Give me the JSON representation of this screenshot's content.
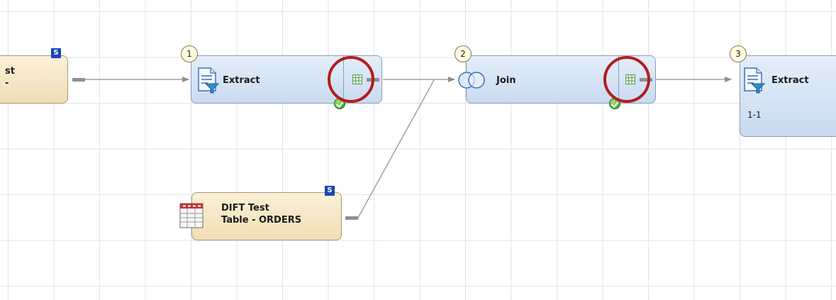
{
  "canvas": {
    "nodes": {
      "source_table": {
        "label": "st\n-",
        "badge": "S"
      },
      "extract_1": {
        "step": "1",
        "label": "Extract"
      },
      "join_2": {
        "step": "2",
        "label": "Join"
      },
      "extract_3": {
        "step": "3",
        "label": "Extract",
        "sublabel": "1-1"
      },
      "orders_table": {
        "label": "DIFT Test\nTable - ORDERS",
        "badge": "S"
      }
    }
  },
  "colors": {
    "transform_node": "#c9dbf0",
    "table_node": "#f0dfb5",
    "highlight": "#b21d1d",
    "status_ok": "#2f9a1c",
    "schema_badge": "#1846b8"
  },
  "icons": {
    "transform": "document-filter-icon",
    "join": "join-circles-icon",
    "table": "table-grid-icon",
    "output": "output-table-icon",
    "status": "checkmark-icon"
  }
}
